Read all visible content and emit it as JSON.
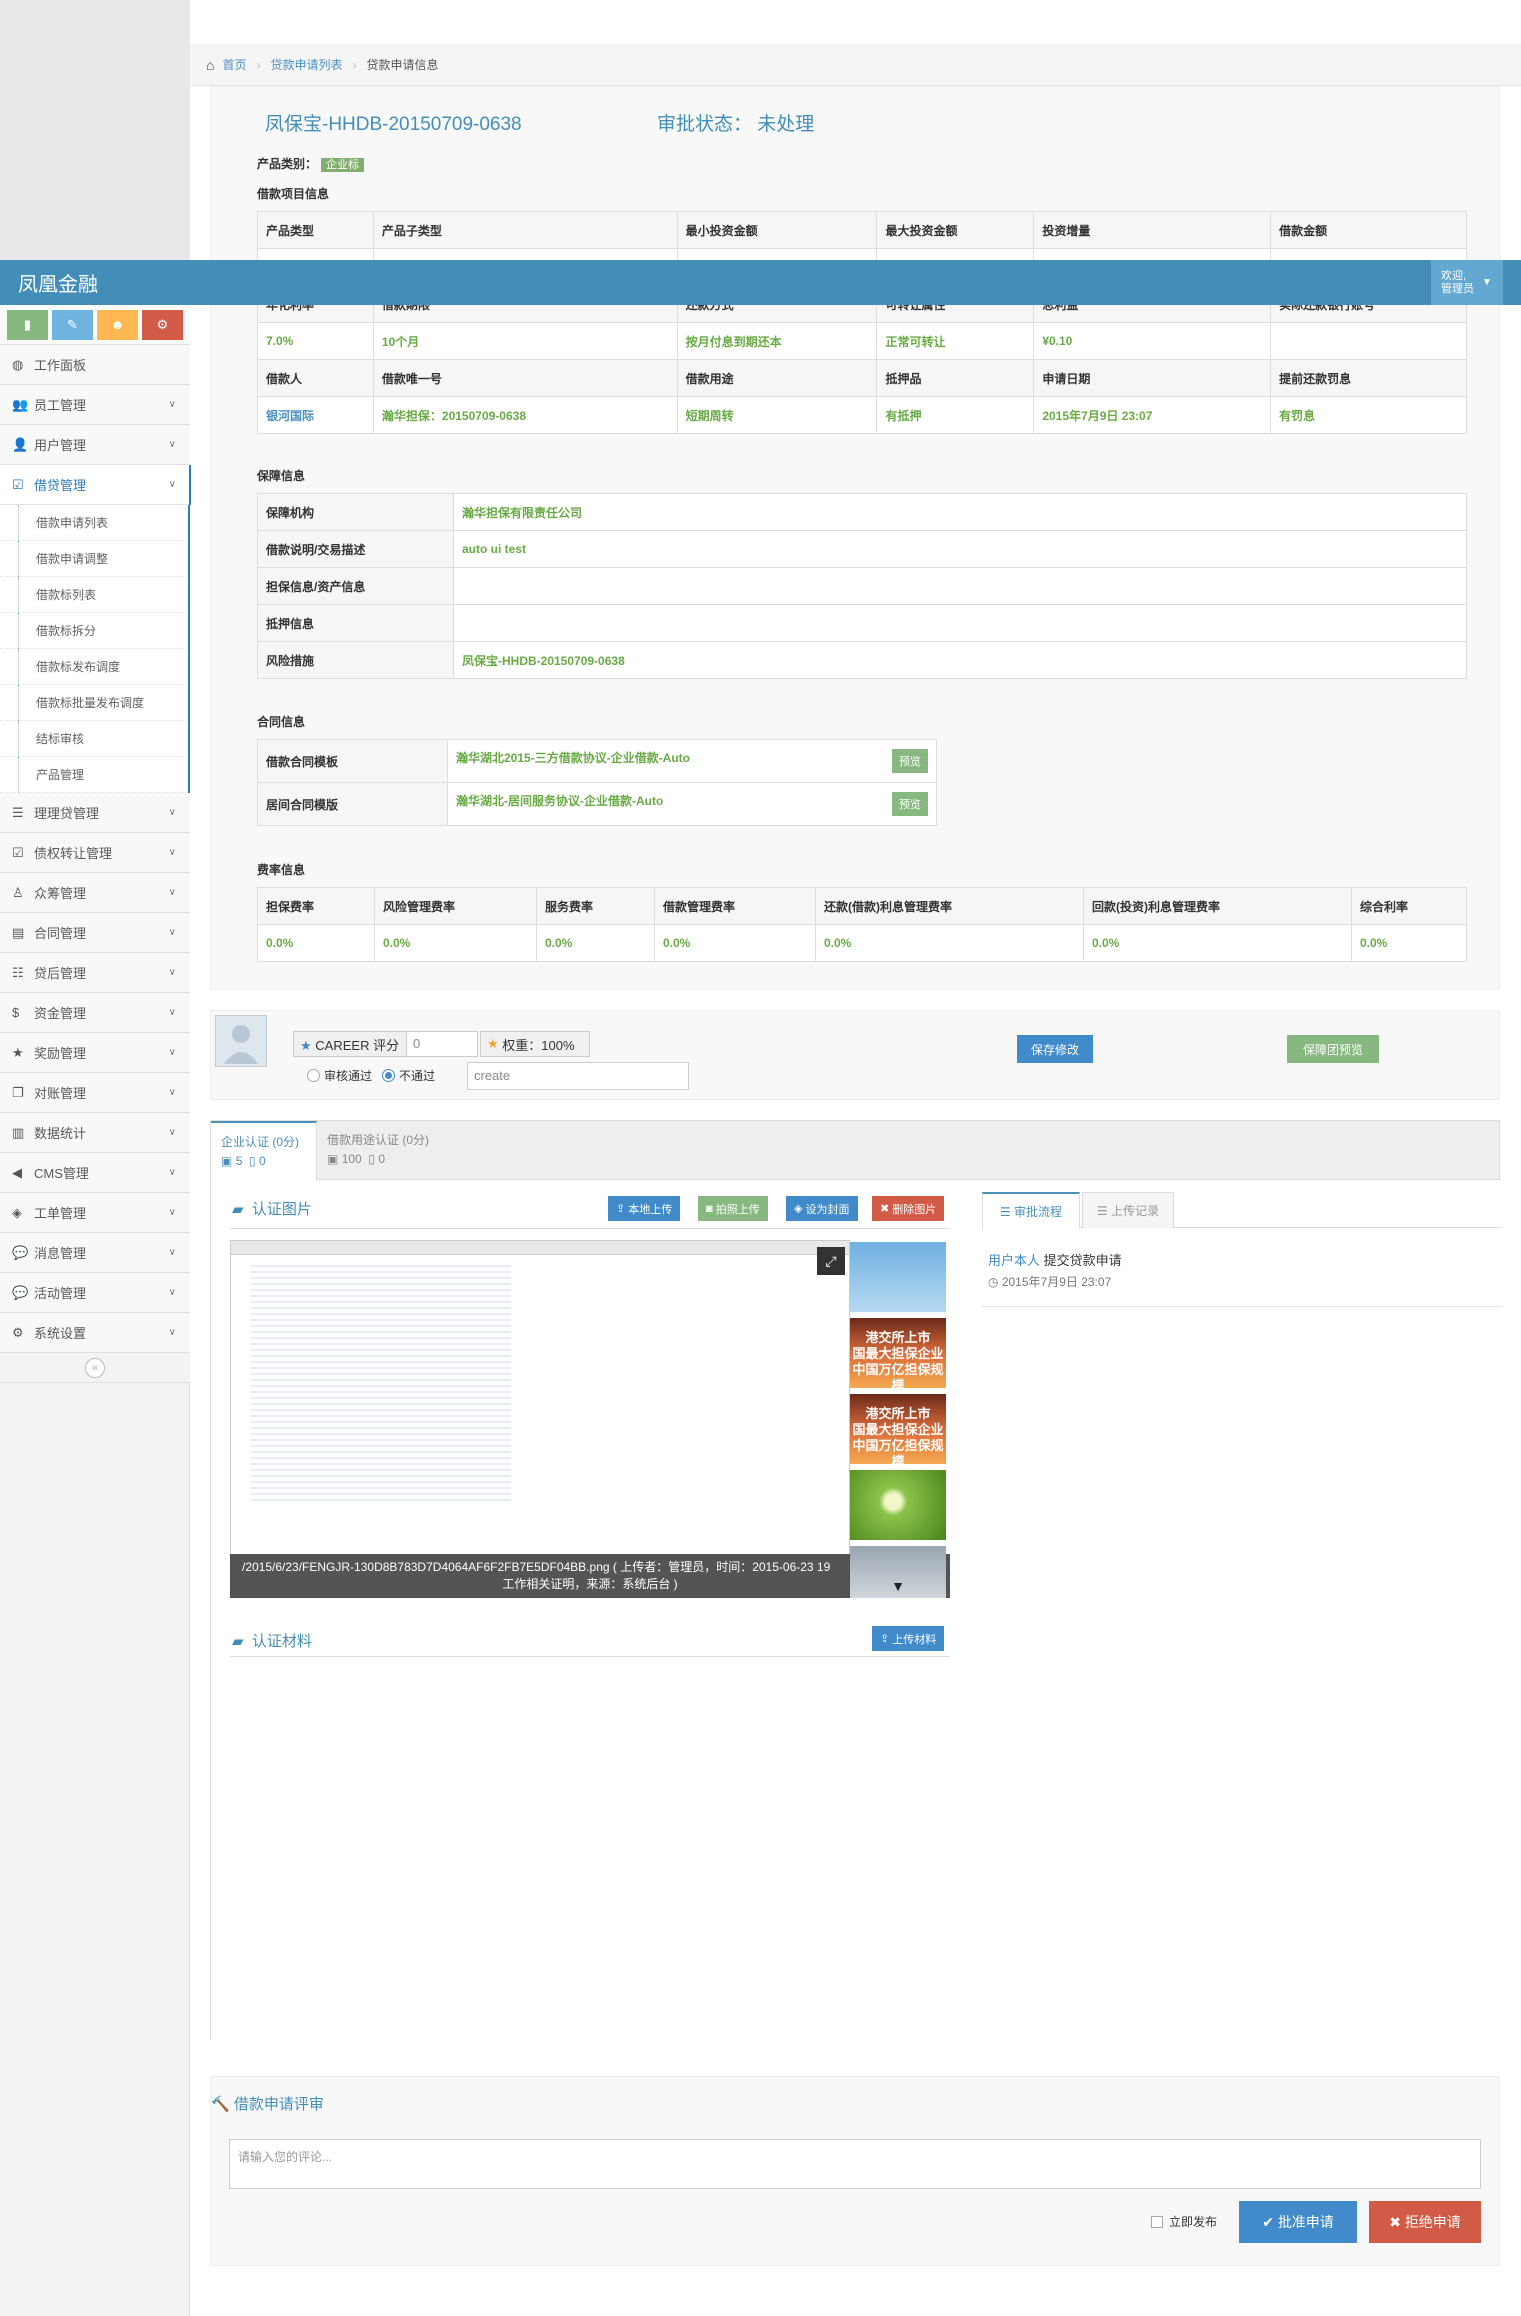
{
  "breadcrumb": {
    "home": "首页",
    "list": "贷款申请列表",
    "current": "贷款申请信息"
  },
  "navbar": {
    "brand": "凤凰金融",
    "welcome": "欢迎,",
    "user": "管理员"
  },
  "sidebar": {
    "items": [
      {
        "label": "工作面板",
        "icon": "dashboard-icon",
        "glyph": "◍"
      },
      {
        "label": "员工管理",
        "icon": "users-icon",
        "glyph": "👥"
      },
      {
        "label": "用户管理",
        "icon": "user-icon",
        "glyph": "👤"
      },
      {
        "label": "借贷管理",
        "icon": "checkbox-icon",
        "glyph": "☑"
      }
    ],
    "submenu": [
      "借款申请列表",
      "借款申请调整",
      "借款标列表",
      "借款标拆分",
      "借款标发布调度",
      "借款标批量发布调度",
      "结标审核",
      "产品管理"
    ],
    "items2": [
      {
        "label": "理理贷管理",
        "icon": "list-icon",
        "glyph": "☰"
      },
      {
        "label": "债权转让管理",
        "icon": "check-square-icon",
        "glyph": "☑"
      },
      {
        "label": "众筹管理",
        "icon": "male-icon",
        "glyph": "♙"
      },
      {
        "label": "合同管理",
        "icon": "file-icon",
        "glyph": "▤"
      },
      {
        "label": "贷后管理",
        "icon": "stack-icon",
        "glyph": "☷"
      },
      {
        "label": "资金管理",
        "icon": "dollar-icon",
        "glyph": "$"
      },
      {
        "label": "奖励管理",
        "icon": "star-icon",
        "glyph": "★"
      },
      {
        "label": "对账管理",
        "icon": "copy-icon",
        "glyph": "❐"
      },
      {
        "label": "数据统计",
        "icon": "bar-chart-icon",
        "glyph": "▥"
      },
      {
        "label": "CMS管理",
        "icon": "bullhorn-icon",
        "glyph": "◀"
      },
      {
        "label": "工单管理",
        "icon": "tag-icon",
        "glyph": "◈"
      },
      {
        "label": "消息管理",
        "icon": "comments-icon",
        "glyph": "💬"
      },
      {
        "label": "活动管理",
        "icon": "comments-icon",
        "glyph": "💬"
      },
      {
        "label": "系统设置",
        "icon": "cogs-icon",
        "glyph": "⚙"
      }
    ],
    "collapse": "«"
  },
  "header": {
    "title": "凤保宝-HHDB-20150709-0638",
    "status_label": "审批状态：",
    "status_value": "未处理"
  },
  "product": {
    "label": "产品类别：",
    "tag": "企业标",
    "section": "借款项目信息"
  },
  "loan_table": {
    "h1": [
      "产品类型",
      "产品子类型",
      "最小投资金额",
      "最大投资金额",
      "投资增量",
      "借款金额"
    ],
    "h2": [
      "年化利率",
      "借款期限",
      "还款方式",
      "可转让属性",
      "总利益",
      "实际还款银行账号"
    ],
    "r2": [
      "7.0%",
      "10个月",
      "按月付息到期还本",
      "正常可转让",
      "¥0.10",
      ""
    ],
    "h3": [
      "借款人",
      "借款唯一号",
      "借款用途",
      "抵押品",
      "申请日期",
      "提前还款罚息"
    ],
    "r3": [
      "银河国际",
      "瀚华担保：20150709-0638",
      "短期周转",
      "有抵押",
      "2015年7月9日 23:07",
      "有罚息"
    ]
  },
  "guarantee": {
    "title": "保障信息",
    "rows": [
      {
        "k": "保障机构",
        "v": "瀚华担保有限责任公司"
      },
      {
        "k": "借款说明/交易描述",
        "v": "auto ui test"
      },
      {
        "k": "担保信息/资产信息",
        "v": ""
      },
      {
        "k": "抵押信息",
        "v": ""
      },
      {
        "k": "风险措施",
        "v": "凤保宝-HHDB-20150709-0638"
      }
    ]
  },
  "contract": {
    "title": "合同信息",
    "rows": [
      {
        "k": "借款合同模板",
        "v": "瀚华湖北2015-三方借款协议-企业借款-Auto",
        "btn": "预览"
      },
      {
        "k": "居间合同模版",
        "v": "瀚华湖北-居间服务协议-企业借款-Auto",
        "btn": "预览"
      }
    ]
  },
  "fees": {
    "title": "费率信息",
    "headers": [
      "担保费率",
      "风险管理费率",
      "服务费率",
      "借款管理费率",
      "还款(借款)利息管理费率",
      "回款(投资)利息管理费率",
      "综合利率"
    ],
    "values": [
      "0.0%",
      "0.0%",
      "0.0%",
      "0.0%",
      "0.0%",
      "0.0%",
      "0.0%"
    ]
  },
  "review": {
    "career_label": "CAREER 评分",
    "career_value": "0",
    "weight_label": "权重：100%",
    "radio_pass": "审核通过",
    "radio_fail": "不通过",
    "input_value": "create",
    "save": "保存修改",
    "guard_preview": "保障团预览"
  },
  "tabs": [
    {
      "label": "企业认证 (0分)",
      "img": "5",
      "doc": "0"
    },
    {
      "label": "借款用途认证 (0分)",
      "img": "100",
      "doc": "0"
    }
  ],
  "images": {
    "title": "认证图片",
    "btn_upload": "本地上传",
    "btn_photo": "拍照上传",
    "btn_cover": "设为封面",
    "btn_delete": "删除图片",
    "caption1": "/2015/6/23/FENGJR-130D8B783D7D4064AF6F2FB7E5DF04BB.png ( 上传者：管理员，时间：2015-06-23 19",
    "caption2": "工作相关证明，来源：系统后台 )",
    "thumb_text1": "港交所上市",
    "thumb_text2": "国最大担保企业",
    "thumb_text3": "中国万亿担保规模",
    "thumb_text4": "港交所上市",
    "thumb_text5": "国最大担保企业",
    "thumb_text6": "中国万亿担保规模"
  },
  "materials": {
    "title": "认证材料",
    "btn": "上传材料"
  },
  "flow": {
    "tab1": "审批流程",
    "tab2": "上传记录",
    "user": "用户本人",
    "action": "提交贷款申请",
    "time": "2015年7月9日 23:07"
  },
  "comment": {
    "title": "借款申请评审",
    "placeholder": "请输入您的评论...",
    "publish": "立即发布",
    "approve": "批准申请",
    "reject": "拒绝申请"
  },
  "colors": {
    "blue": "#438eb9",
    "green": "#69aa46",
    "red": "#d15b47",
    "btn_blue": "#428bca"
  }
}
